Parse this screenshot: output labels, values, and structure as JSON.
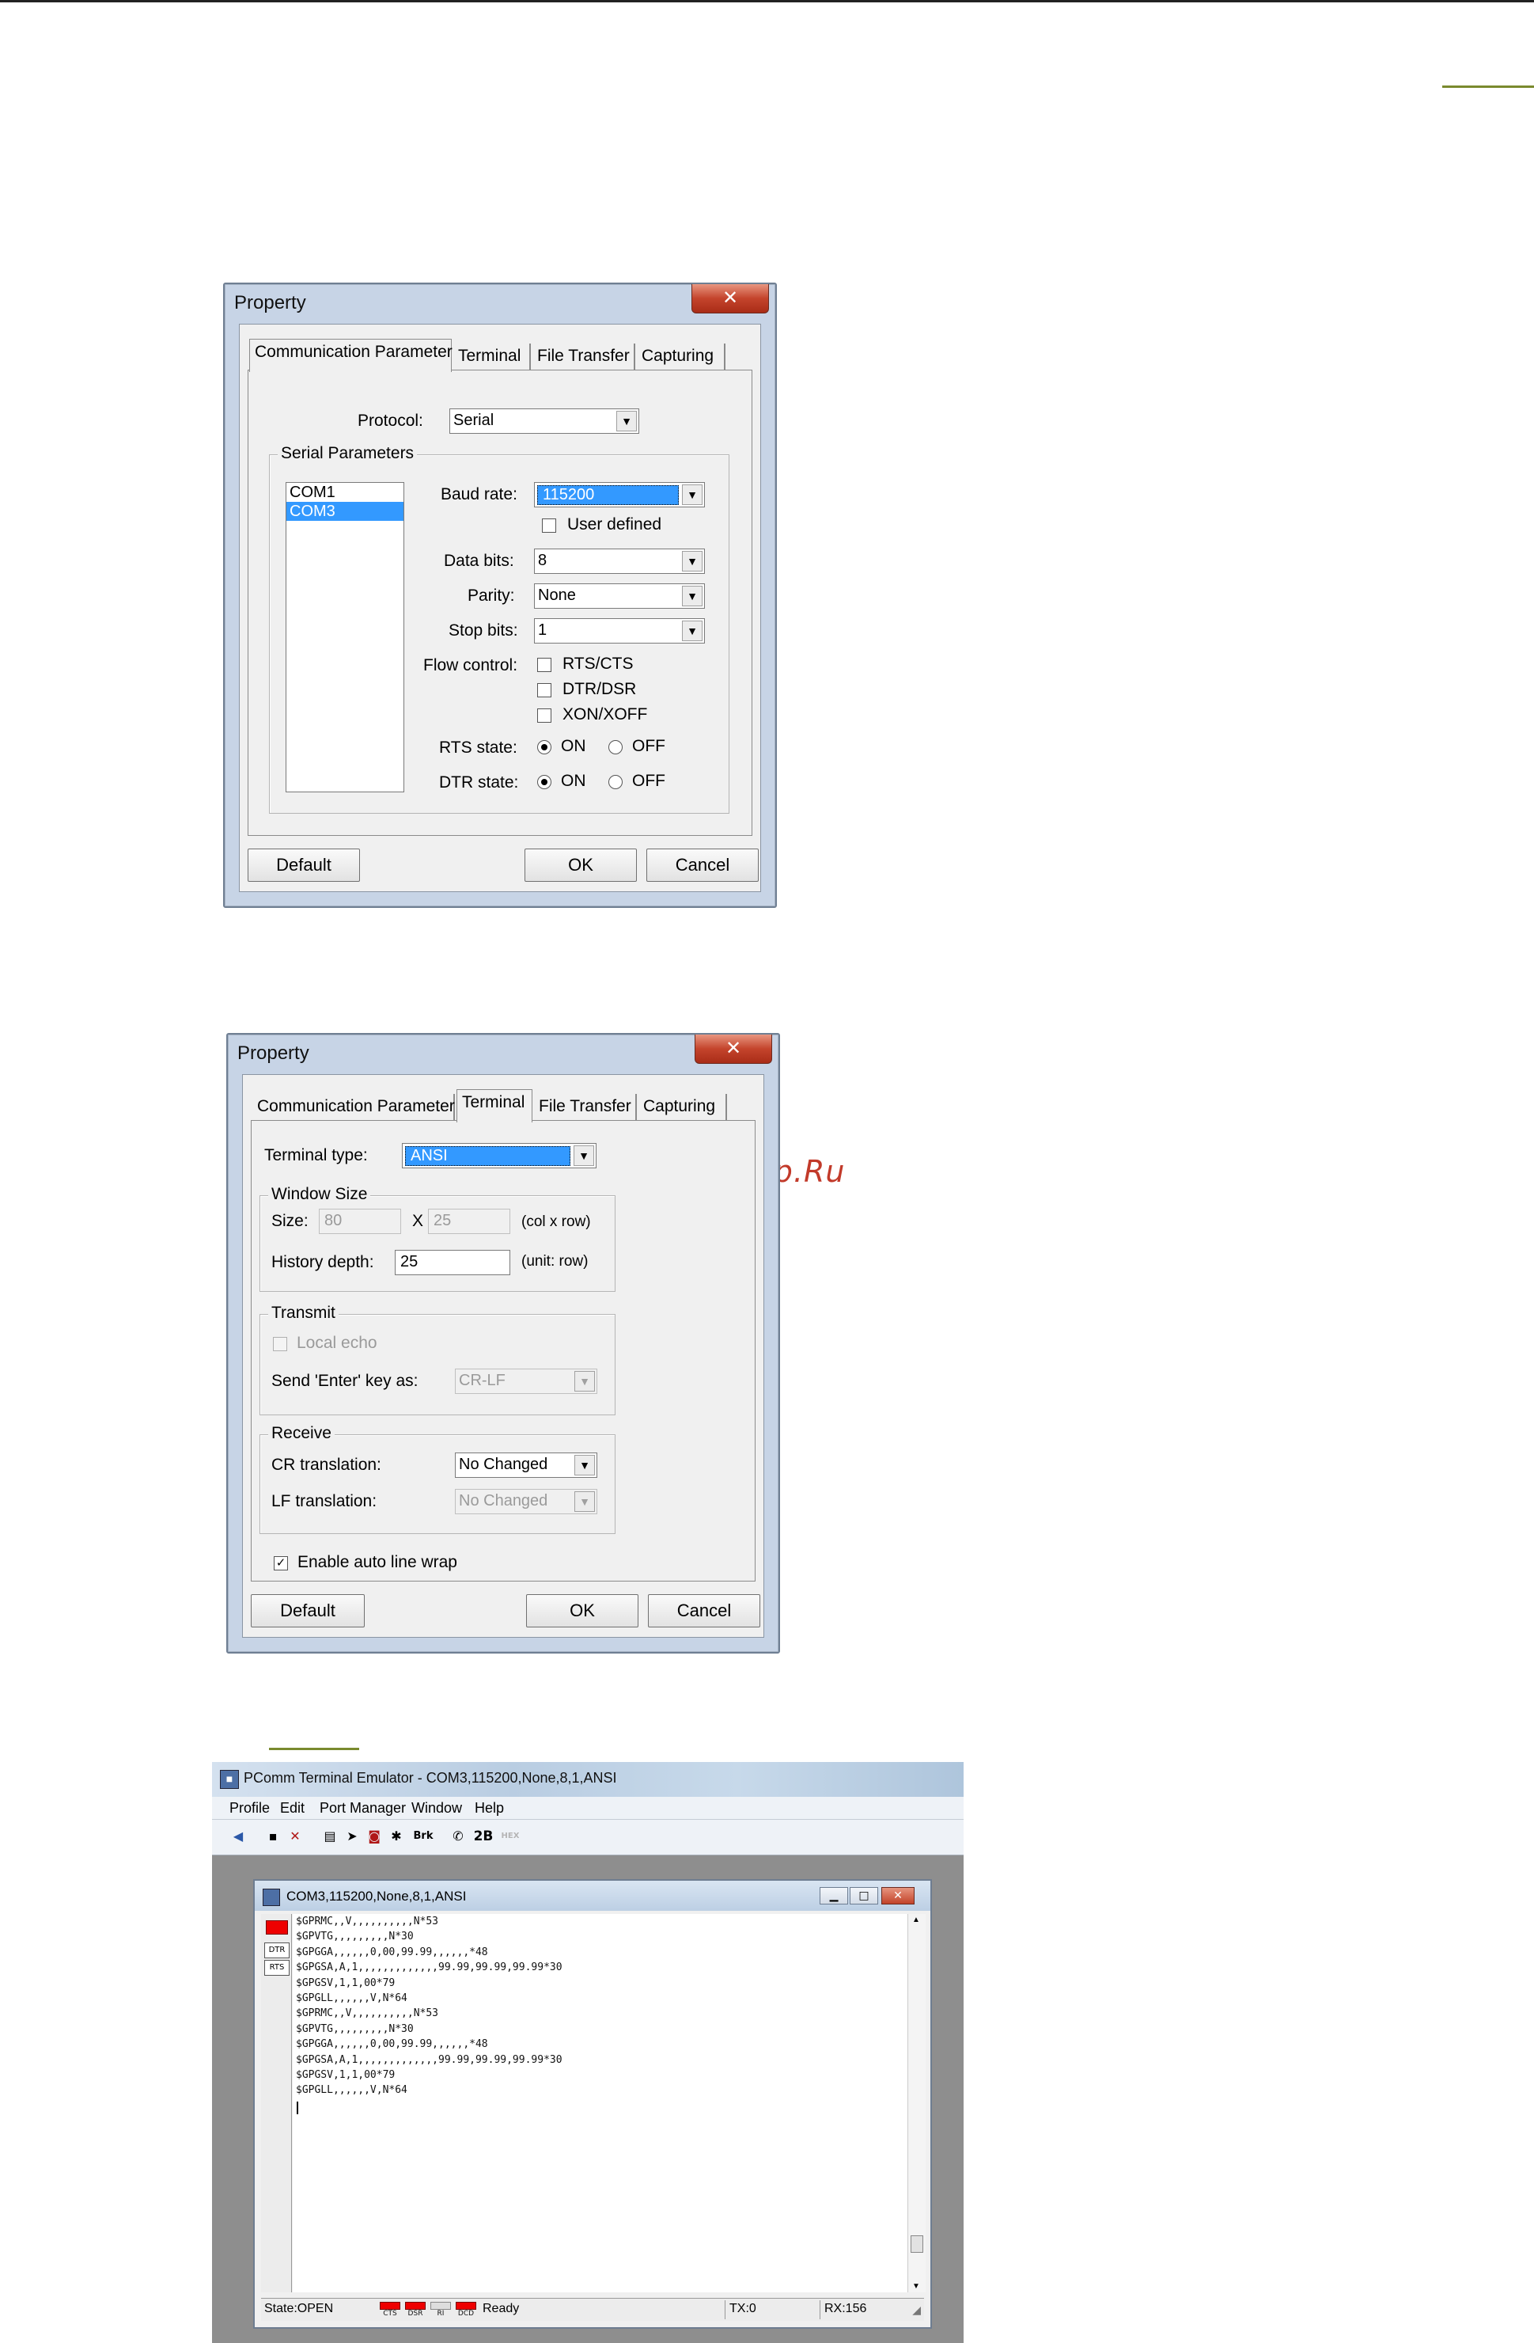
{
  "dialog1": {
    "title": "Property",
    "close_glyph": "✕",
    "tabs": [
      "Communication Parameter",
      "Terminal",
      "File Transfer",
      "Capturing"
    ],
    "protocol_label": "Protocol:",
    "protocol_value": "Serial",
    "serial_group": "Serial Parameters",
    "ports": [
      "COM1",
      "COM3"
    ],
    "baud_label": "Baud rate:",
    "baud_value": "115200",
    "user_defined": "User defined",
    "databits_label": "Data bits:",
    "databits_value": "8",
    "parity_label": "Parity:",
    "parity_value": "None",
    "stopbits_label": "Stop bits:",
    "stopbits_value": "1",
    "flow_label": "Flow control:",
    "flow_options": [
      "RTS/CTS",
      "DTR/DSR",
      "XON/XOFF"
    ],
    "rts_label": "RTS state:",
    "dtr_label": "DTR state:",
    "on": "ON",
    "off": "OFF",
    "default_btn": "Default",
    "ok_btn": "OK",
    "cancel_btn": "Cancel"
  },
  "dialog2": {
    "title": "Property",
    "close_glyph": "✕",
    "tabs": [
      "Communication Parameter",
      "Terminal",
      "File Transfer",
      "Capturing"
    ],
    "terminal_type_label": "Terminal type:",
    "terminal_type_value": "ANSI",
    "window_size_group": "Window Size",
    "size_label": "Size:",
    "size_cols": "80",
    "size_x": "X",
    "size_rows": "25",
    "size_unit": "(col x row)",
    "history_label": "History depth:",
    "history_value": "25",
    "history_unit": "(unit: row)",
    "transmit_group": "Transmit",
    "local_echo": "Local echo",
    "send_enter_label": "Send 'Enter' key  as:",
    "send_enter_value": "CR-LF",
    "receive_group": "Receive",
    "cr_label": "CR translation:",
    "cr_value": "No Changed",
    "lf_label": "LF translation:",
    "lf_value": "No Changed",
    "auto_wrap": "Enable auto line wrap",
    "check_glyph": "✓",
    "default_btn": "Default",
    "ok_btn": "OK",
    "cancel_btn": "Cancel"
  },
  "emulator": {
    "title": "PComm Terminal Emulator - COM3,115200,None,8,1,ANSI",
    "menu": [
      "Profile",
      "Edit",
      "Port Manager",
      "Window",
      "Help"
    ],
    "toolbar_text": [
      "Brk",
      "2B",
      "HEX"
    ],
    "child_title": "COM3,115200,None,8,1,ANSI",
    "side_badges": [
      "DTR",
      "RTS"
    ],
    "lines": [
      "$GPRMC,,V,,,,,,,,,,N*53",
      "$GPVTG,,,,,,,,,N*30",
      "$GPGGA,,,,,,0,00,99.99,,,,,,*48",
      "$GPGSA,A,1,,,,,,,,,,,,,99.99,99.99,99.99*30",
      "$GPGSV,1,1,00*79",
      "$GPGLL,,,,,,V,N*64",
      "$GPRMC,,V,,,,,,,,,,N*53",
      "$GPVTG,,,,,,,,,N*30",
      "$GPGGA,,,,,,0,00,99.99,,,,,,*48",
      "$GPGSA,A,1,,,,,,,,,,,,,99.99,99.99,99.99*30",
      "$GPGSV,1,1,00*79",
      "$GPGLL,,,,,,V,N*64"
    ],
    "status": {
      "state": "State:OPEN",
      "leds": [
        "CTS",
        "DSR",
        "RI",
        "DCD"
      ],
      "ready": "Ready",
      "tx": "TX:0",
      "rx": "RX:156"
    }
  },
  "watermark": "McGrp.Ru"
}
